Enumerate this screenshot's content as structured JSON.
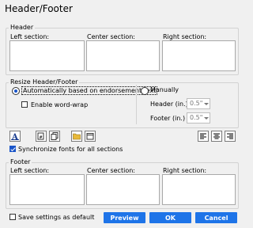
{
  "window": {
    "title": "Header/Footer"
  },
  "header_group": {
    "label": "Header",
    "left_label": "Left section:",
    "center_label": "Center section:",
    "right_label": "Right section:"
  },
  "resize_group": {
    "label": "Resize Header/Footer",
    "auto_label": "Automatically based on endorsement text",
    "wordwrap_label": "Enable word-wrap",
    "manual_label": "Manually",
    "header_in_label": "Header (in.)",
    "header_in_value": "0.5\"",
    "footer_in_label": "Footer (in.)",
    "footer_in_value": "0.5\"",
    "selected": "auto",
    "wordwrap_checked": false
  },
  "toolbar": {
    "font_icon": "font-icon",
    "page_number_icon": "page-number-icon",
    "total_pages_icon": "total-pages-icon",
    "folder_icon": "folder-icon",
    "date_icon": "date-icon",
    "align_left_icon": "align-left-icon",
    "align_center_icon": "align-center-icon",
    "align_right_icon": "align-right-icon"
  },
  "sync_fonts": {
    "label": "Synchronize fonts for all sections",
    "checked": true
  },
  "footer_group": {
    "label": "Footer",
    "left_label": "Left section:",
    "center_label": "Center section:",
    "right_label": "Right section:"
  },
  "bottom": {
    "save_default_label": "Save settings as default",
    "save_default_checked": false,
    "preview_label": "Preview",
    "ok_label": "OK",
    "cancel_label": "Cancel"
  },
  "colors": {
    "accent": "#1e74e8",
    "panel": "#f0f0f0"
  }
}
